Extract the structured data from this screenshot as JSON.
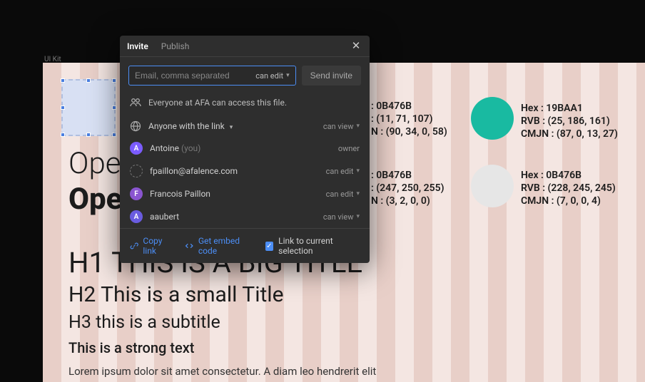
{
  "canvas": {
    "label": "UI Kit",
    "typography": {
      "open_light": "Ope",
      "open_bold": "Ope",
      "h1": "H1 THIS IS A BIG TITLE",
      "h2": "H2 This is a small Title",
      "h3": "H3 this is a subtitle",
      "strong": "This is a strong text",
      "paragraph": "Lorem ipsum dolor sit amet consectetur. A diam leo hendrerit elit"
    },
    "color_left_top": {
      "hex": ": 0B476B",
      "rvb": ": (11, 71, 107)",
      "cmjn": "N : (90, 34, 0, 58)"
    },
    "color_left_bot": {
      "hex": ": 0B476B",
      "rvb": ": (247, 250, 255)",
      "cmjn": "N : (3, 2, 0, 0)"
    },
    "color_right_top": {
      "hex": "Hex : 19BAA1",
      "rvb": "RVB : (25, 186, 161)",
      "cmjn": "CMJN : (87, 0, 13, 27)"
    },
    "color_right_bot": {
      "hex": "Hex : 0B476B",
      "rvb": "RVB : (228, 245, 245)",
      "cmjn": "CMJN : (7, 0, 0, 4)"
    }
  },
  "modal": {
    "tabs": {
      "invite": "Invite",
      "publish": "Publish"
    },
    "email_placeholder": "Email, comma separated",
    "perm_can_edit": "can edit",
    "perm_can_view": "can view",
    "send": "Send invite",
    "info": "Everyone at AFA can access this file.",
    "anyone_link": "Anyone with the link",
    "people": [
      {
        "initial": "A",
        "name": "Antoine",
        "you": "(you)",
        "perm": "owner",
        "color": "#7b5cff"
      },
      {
        "initial": "",
        "name": "fpaillon@afalence.com",
        "you": "",
        "perm": "can edit",
        "color": ""
      },
      {
        "initial": "F",
        "name": "Francois Paillon",
        "you": "",
        "perm": "can edit",
        "color": "#8a55d0"
      },
      {
        "initial": "A",
        "name": "aaubert",
        "you": "",
        "perm": "can view",
        "color": "#6a5ce0"
      }
    ],
    "footer": {
      "copy_link": "Copy link",
      "embed": "Get embed code",
      "link_selection": "Link to current selection"
    }
  }
}
